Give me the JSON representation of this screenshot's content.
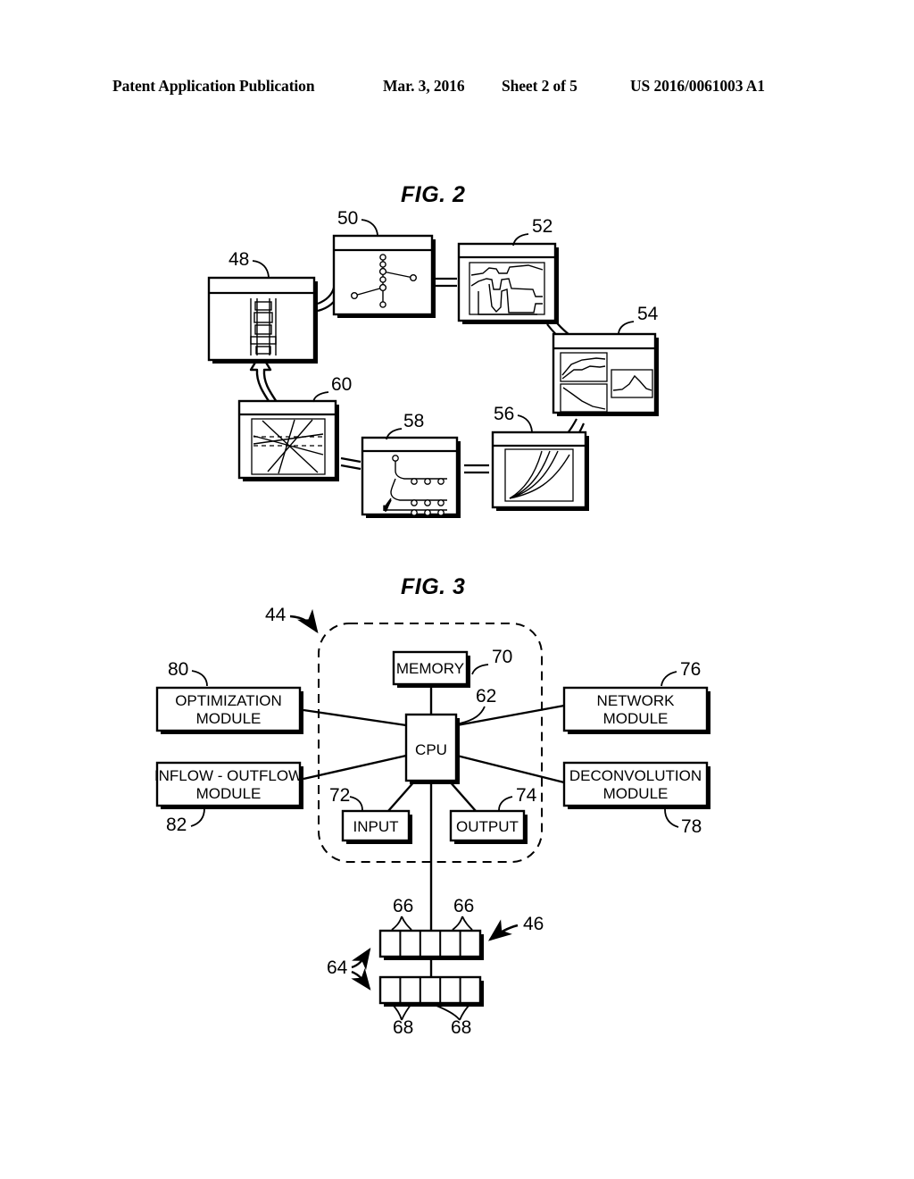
{
  "header": {
    "publication": "Patent Application Publication",
    "date": "Mar. 3, 2016",
    "sheet": "Sheet 2 of 5",
    "patent_number": "US 2016/0061003 A1"
  },
  "figures": [
    {
      "caption": "FIG. 2",
      "description": "Cyclic workflow of six display/monitor panels connected by double-line links, with a hollow curved arrow returning from panel 60 to panel 48.",
      "nodes": [
        {
          "ref": "48",
          "content": "wellbore-tubing-string-schematic"
        },
        {
          "ref": "50",
          "content": "node-network-diagram"
        },
        {
          "ref": "52",
          "content": "well-log-track-curves"
        },
        {
          "ref": "54",
          "content": "multi-panel-production-charts"
        },
        {
          "ref": "56",
          "content": "decline-curve-fan-plot"
        },
        {
          "ref": "58",
          "content": "multilateral-completion-tree"
        },
        {
          "ref": "60",
          "content": "crossplot-with-dashed-cutoffs"
        }
      ]
    },
    {
      "caption": "FIG. 3",
      "description": "Computer system block diagram. A dashed rounded enclosure (44) holds MEMORY, CPU, INPUT and OUTPUT. Four external modules connect to the CPU. A data/storage array (46) sits below.",
      "enclosure_ref": "44",
      "blocks": [
        {
          "ref": "70",
          "label": "MEMORY"
        },
        {
          "ref": "62",
          "label": "CPU"
        },
        {
          "ref": "72",
          "label": "INPUT"
        },
        {
          "ref": "74",
          "label": "OUTPUT"
        },
        {
          "ref": "80",
          "label": "OPTIMIZATION MODULE",
          "line1": "OPTIMIZATION",
          "line2": "MODULE"
        },
        {
          "ref": "82",
          "label": "INFLOW - OUTFLOW MODULE",
          "line1": "INFLOW - OUTFLOW",
          "line2": "MODULE"
        },
        {
          "ref": "76",
          "label": "NETWORK MODULE",
          "line1": "NETWORK",
          "line2": "MODULE"
        },
        {
          "ref": "78",
          "label": "DECONVOLUTION MODULE",
          "line1": "DECONVOLUTION",
          "line2": "MODULE"
        }
      ],
      "storage": {
        "ref": "46",
        "bracket_ref": "64",
        "upper_cell_ref": "66",
        "lower_cell_ref": "68",
        "cells_per_bar": 5,
        "bars": 2
      }
    }
  ],
  "reference_numerals": {
    "n44": "44",
    "n46": "46",
    "n48": "48",
    "n50": "50",
    "n52": "52",
    "n54": "54",
    "n56": "56",
    "n58": "58",
    "n60": "60",
    "n62": "62",
    "n64": "64",
    "n66a": "66",
    "n66b": "66",
    "n68a": "68",
    "n68b": "68",
    "n70": "70",
    "n72": "72",
    "n74": "74",
    "n76": "76",
    "n78": "78",
    "n80": "80",
    "n82": "82"
  },
  "labels": {
    "memory": "MEMORY",
    "cpu": "CPU",
    "input": "INPUT",
    "output": "OUTPUT",
    "optimization_1": "OPTIMIZATION",
    "optimization_2": "MODULE",
    "inflow_1": "INFLOW - OUTFLOW",
    "inflow_2": "MODULE",
    "network_1": "NETWORK",
    "network_2": "MODULE",
    "deconvolution_1": "DECONVOLUTION",
    "deconvolution_2": "MODULE"
  },
  "colors": {
    "ink": "#000000",
    "paper": "#ffffff"
  }
}
